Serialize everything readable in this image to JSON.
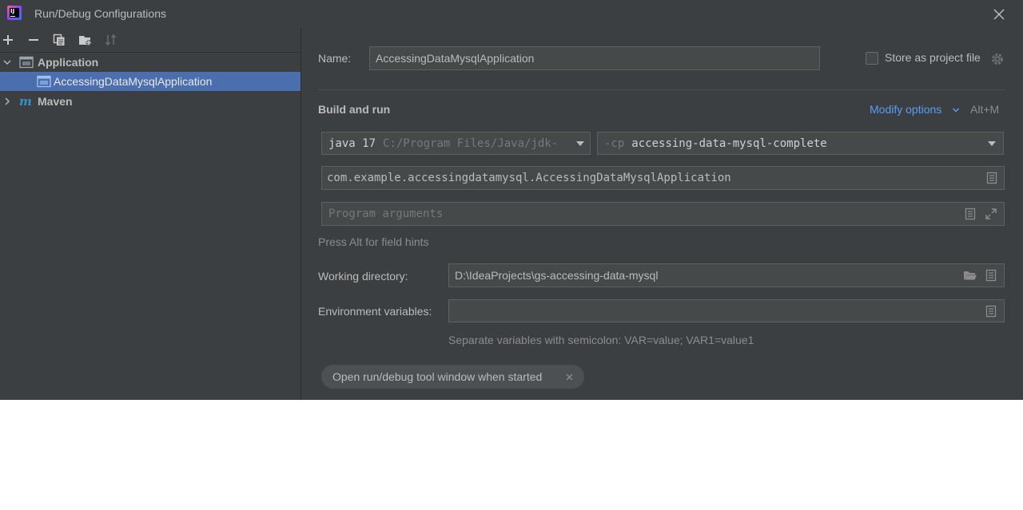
{
  "window": {
    "title": "Run/Debug Configurations"
  },
  "toolbar": {
    "icons": [
      "add-icon",
      "remove-icon",
      "copy-icon",
      "new-folder-icon",
      "sort-icon"
    ]
  },
  "tree": {
    "items": [
      {
        "label": "Application",
        "icon": "application-icon",
        "expanded": true,
        "bold": true
      },
      {
        "label": "AccessingDataMysqlApplication",
        "icon": "application-config-icon",
        "selected": true
      },
      {
        "label": "Maven",
        "icon": "maven-icon",
        "expanded": false,
        "bold": true
      }
    ]
  },
  "form": {
    "name_label": "Name:",
    "name_value": "AccessingDataMysqlApplication",
    "store_label": "Store as project file",
    "store_checked": false,
    "section_title": "Build and run",
    "modify_options": "Modify options",
    "modify_shortcut": "Alt+M",
    "jdk_name": "java 17",
    "jdk_path": "C:/Program Files/Java/jdk-",
    "cp_prefix": "-cp",
    "cp_value": "accessing-data-mysql-complete",
    "main_class": "com.example.accessingdatamysql.AccessingDataMysqlApplication",
    "program_args_placeholder": "Program arguments",
    "field_hint": "Press Alt for field hints",
    "working_dir_label": "Working directory:",
    "working_dir_value": "D:\\IdeaProjects\\gs-accessing-data-mysql",
    "env_label": "Environment variables:",
    "env_value": "",
    "env_hint": "Separate variables with semicolon: VAR=value; VAR1=value1",
    "chip_label": "Open run/debug tool window when started"
  },
  "colors": {
    "background": "#3c3f41",
    "field_bg": "#45494a",
    "selection": "#4b6eaf",
    "link": "#589df6",
    "text": "#bbbbbb"
  }
}
